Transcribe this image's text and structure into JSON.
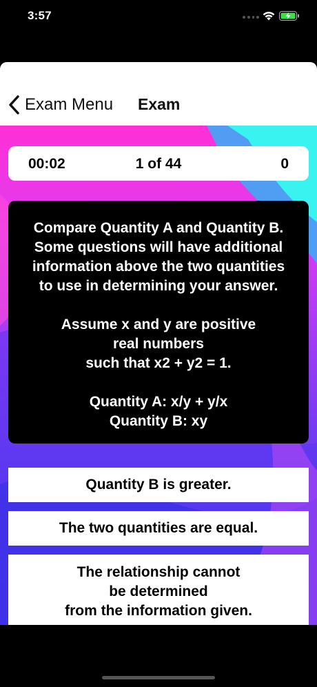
{
  "status_bar": {
    "time": "3:57",
    "icons": [
      "signal-dots-icon",
      "wifi-icon",
      "battery-charging-icon"
    ]
  },
  "nav": {
    "back_label": "Exam Menu",
    "back_icon": "chevron-left-icon",
    "title": "Exam"
  },
  "info_bar": {
    "timer": "00:02",
    "progress": "1 of 44",
    "score": "0"
  },
  "question": {
    "instructions": "Compare Quantity A and Quantity B.\nSome questions will have additional\ninformation above the two quantities\nto use in determining your answer.",
    "given": "Assume x and y are positive\nreal numbers\nsuch that x2 + y2 = 1.",
    "quantity_a": "Quantity A: x/y + y/x",
    "quantity_b": "Quantity B: xy"
  },
  "answers": [
    {
      "label": "Quantity B is greater."
    },
    {
      "label": "The two quantities are equal."
    },
    {
      "label": "The relationship cannot\nbe determined\nfrom the information given."
    }
  ],
  "colors": {
    "gradient_top": "#ff2fd6",
    "gradient_bottom": "#3a3be8",
    "accent_cyan": "#39f3f0"
  }
}
